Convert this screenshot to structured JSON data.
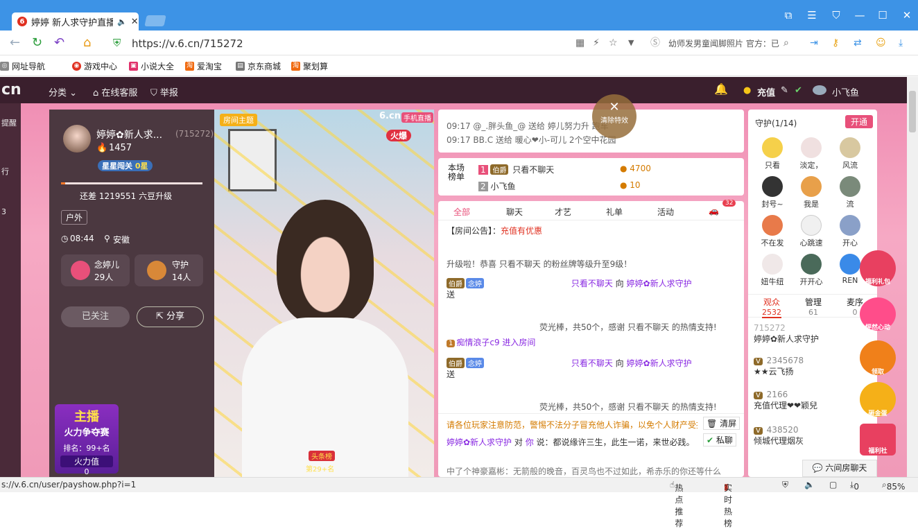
{
  "browser": {
    "tab_title": "婷婷 新人求守护直播",
    "url": "https://v.6.cn/715272",
    "search_text": "幼师发男童闻脚照片 官方：已",
    "bookmarks": [
      "网址导航",
      "游戏中心",
      "小说大全",
      "爱淘宝",
      "京东商城",
      "聚划算"
    ]
  },
  "site": {
    "logo": "cn",
    "nav": [
      "分类",
      "在线客服",
      "举报"
    ],
    "recharge": "充值",
    "username": "小飞鱼"
  },
  "left_strip": [
    "提醒",
    "行",
    "3"
  ],
  "anchor": {
    "name": "婷婷✿新人求...",
    "room_id": "(715272)",
    "fans": "1457",
    "level_badge": "星星闯关",
    "level_stars": "0星",
    "upgrade_text": "还差 1219551 六豆升级",
    "tag": "户外",
    "time": "08:44",
    "location": "安徽",
    "fanclub_label": "念婷儿",
    "fanclub_count": "29人",
    "guard_label": "守护",
    "guard_count": "14人",
    "follow_btn": "已关注",
    "share_btn": "分享",
    "contest_title": "主播",
    "contest_sub": "火力争夺赛",
    "rank": "排名：99+名",
    "firepower_label": "火力值",
    "firepower_value": "0"
  },
  "video": {
    "room_theme": "房间主题",
    "brand": "6.cn",
    "badge": "手机直播",
    "hot": "火爆",
    "headline": "头条榜",
    "headline_rank": "第29+名"
  },
  "gift_log": [
    {
      "time": "09:17",
      "text": "@_.胖头鱼_@ 送给 婷儿努力升 跑车"
    },
    {
      "time": "09:17",
      "text": "BB.C 送给 暖心❤小-可儿 2个空中花园"
    }
  ],
  "close_effects": "清除特效",
  "leaderboard": {
    "label": "本场\n榜单",
    "rows": [
      {
        "rank": "1",
        "badge": "伯爵",
        "name": "只看不聊天",
        "score": "4700"
      },
      {
        "rank": "2",
        "badge": "",
        "name": "小飞鱼",
        "score": "10"
      }
    ]
  },
  "chat_tabs": [
    "全部",
    "聊天",
    "才艺",
    "礼单",
    "活动"
  ],
  "chat_tab_badge": "32",
  "announcement": {
    "label": "【房间公告】：",
    "link": "充值有优惠"
  },
  "chat": [
    {
      "text": "升级啦！恭喜 只看不聊天 的粉丝牌等级升至9级！"
    },
    {
      "badge": "伯爵",
      "fan": "念婷",
      "user": "只看不聊天",
      "action": "向",
      "target": "婷婷✿新人求守护",
      "suffix": "送"
    },
    {
      "text": "荧光棒，共50个，感谢 只看不聊天 的热情支持!"
    },
    {
      "text": "痴情浪子c9 进入房间"
    },
    {
      "badge": "伯爵",
      "fan": "念婷",
      "user": "只看不聊天",
      "action": "向",
      "target": "婷婷✿新人求守护",
      "suffix": "送"
    },
    {
      "text": "荧光棒，共50个，感谢 只看不聊天 的热情支持!"
    }
  ],
  "warning": "请各位玩家注意防范，警惕不法分子冒充他人诈骗，以免个人财产受损。",
  "clear_btn": "清屏",
  "private_btn": "私聊",
  "broadcast": {
    "from": "婷婷✿新人求守护",
    "to": "你",
    "text": "都说缘许三生，此生一诺，来世必践。"
  },
  "bottom_notice": "中了个神豪嘉彬：无箭般的晚音，百灵鸟也不过如此，希赤乐的你还等什么",
  "guards": {
    "title": "守护",
    "count": "(1/14)",
    "open_btn": "开通",
    "list": [
      "只看",
      "淡定，",
      "风流",
      "封号~",
      "我是",
      "流",
      "不在发",
      "心跳速",
      "开心",
      "妞牛纽",
      "开开心",
      "REN"
    ]
  },
  "tabs_right": [
    {
      "label": "观众",
      "count": "2532"
    },
    {
      "label": "管理",
      "count": "61"
    },
    {
      "label": "麦序",
      "count": "0"
    }
  ],
  "audience": [
    {
      "id": "715272",
      "name": "婷婷✿新人求守护"
    },
    {
      "id": "2345678",
      "name": "★★云飞扬"
    },
    {
      "id": "2166",
      "name": "充值代理❤❤颖兒"
    },
    {
      "id": "438520",
      "name": "倾城代理烟灰"
    }
  ],
  "promos": [
    "福利礼包",
    "怦然心动",
    "领取",
    "砸金蛋",
    "福利社"
  ],
  "chat_bar": "六间房聊天",
  "status": {
    "url": "s://v.6.cn/user/payshow.php?i=1",
    "hot": "热点推荐",
    "live": "实时热榜",
    "count": "0",
    "zoom": "85%"
  }
}
